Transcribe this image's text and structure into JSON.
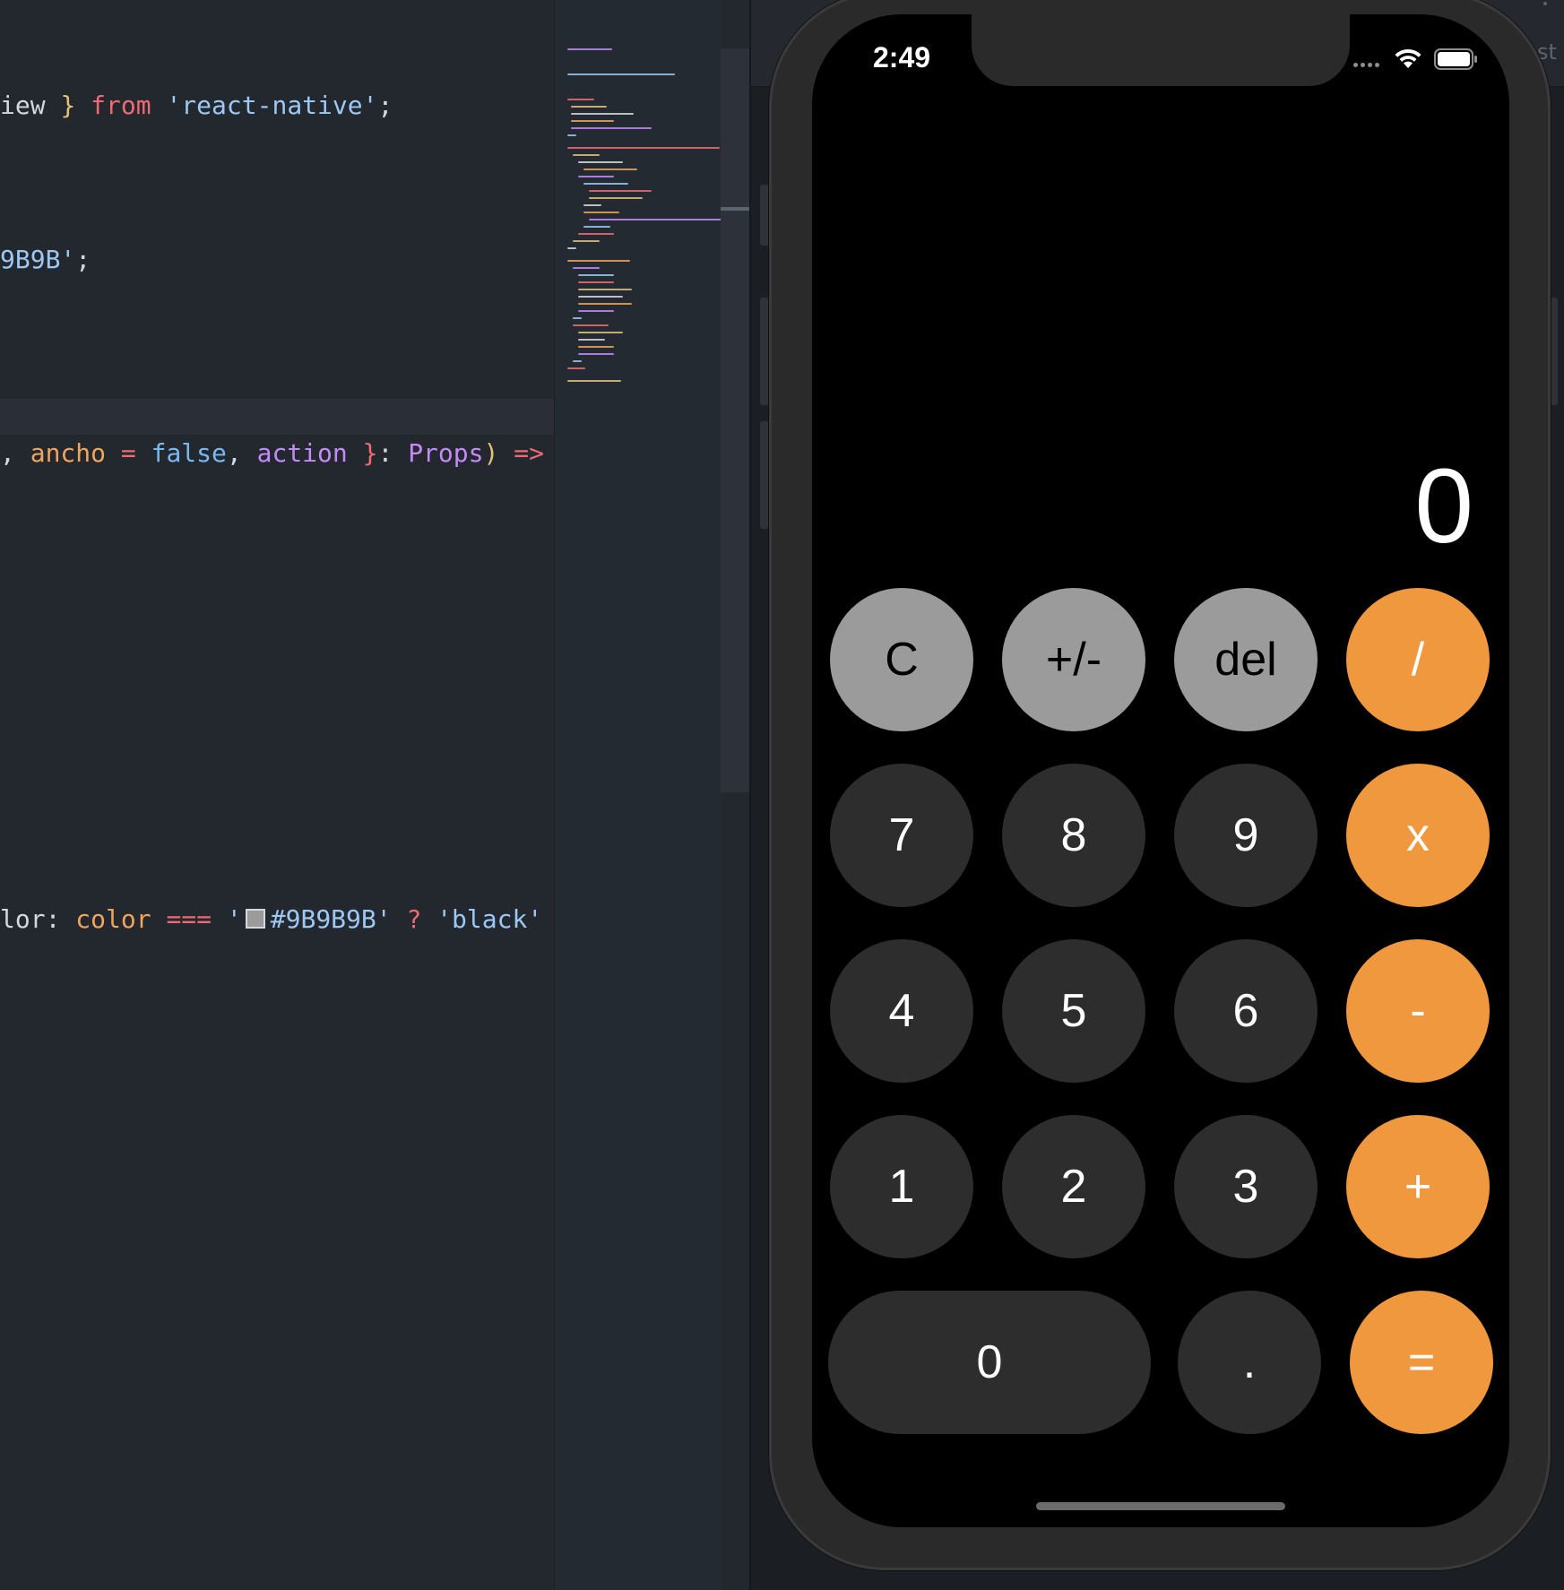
{
  "editor": {
    "lines": [
      [
        [
          "tk-plain",
          "iew "
        ],
        [
          "tk-brace",
          "}"
        ],
        [
          "tk-kw",
          " from "
        ],
        [
          "tk-str",
          "'react-native'"
        ],
        [
          "tk-plain",
          ";"
        ]
      ],
      [
        [
          "tk-str",
          "9B9B'"
        ],
        [
          "tk-plain",
          ";"
        ]
      ],
      [
        [
          "tk-plain",
          ", "
        ],
        [
          "tk-param",
          "ancho"
        ],
        [
          "tk-op",
          " = "
        ],
        [
          "tk-bool",
          "false"
        ],
        [
          "tk-plain",
          ", "
        ],
        [
          "tk-name",
          "action"
        ],
        [
          "tk-plain",
          " "
        ],
        [
          "tk-kw",
          "}"
        ],
        [
          "tk-plain",
          ": "
        ],
        [
          "tk-type",
          "Props"
        ],
        [
          "tk-paren",
          ")"
        ],
        [
          "tk-op",
          " =>"
        ]
      ],
      [
        [
          "tk-plain",
          "lor: "
        ],
        [
          "tk-param",
          "color"
        ],
        [
          "tk-op",
          " === "
        ],
        [
          "tk-str",
          "'"
        ],
        [
          "swatch",
          ""
        ],
        [
          "tk-str",
          "#9B9B9B'"
        ],
        [
          "tk-op",
          " ? "
        ],
        [
          "tk-str",
          "'black'"
        ]
      ]
    ]
  },
  "simulator": {
    "side_text": "st"
  },
  "phone": {
    "status": {
      "time": "2:49",
      "wifi_icon": "wifi-icon",
      "battery_icon": "battery-icon",
      "signal_icon": "cellular-signal-icon"
    },
    "display_value": "0",
    "colors": {
      "light_gray": "#9B9B9B",
      "dark_gray": "#2D2D2D",
      "orange": "#F0983E",
      "background": "#000000"
    },
    "buttons": [
      [
        {
          "label": "C",
          "style": "light",
          "name": "clear-button"
        },
        {
          "label": "+/-",
          "style": "light",
          "name": "toggle-sign-button"
        },
        {
          "label": "del",
          "style": "light",
          "name": "delete-button"
        },
        {
          "label": "/",
          "style": "orange",
          "name": "divide-button"
        }
      ],
      [
        {
          "label": "7",
          "style": "dark",
          "name": "digit-7-button"
        },
        {
          "label": "8",
          "style": "dark",
          "name": "digit-8-button"
        },
        {
          "label": "9",
          "style": "dark",
          "name": "digit-9-button"
        },
        {
          "label": "x",
          "style": "orange",
          "name": "multiply-button"
        }
      ],
      [
        {
          "label": "4",
          "style": "dark",
          "name": "digit-4-button"
        },
        {
          "label": "5",
          "style": "dark",
          "name": "digit-5-button"
        },
        {
          "label": "6",
          "style": "dark",
          "name": "digit-6-button"
        },
        {
          "label": "-",
          "style": "orange",
          "name": "subtract-button"
        }
      ],
      [
        {
          "label": "1",
          "style": "dark",
          "name": "digit-1-button"
        },
        {
          "label": "2",
          "style": "dark",
          "name": "digit-2-button"
        },
        {
          "label": "3",
          "style": "dark",
          "name": "digit-3-button"
        },
        {
          "label": "+",
          "style": "orange",
          "name": "add-button"
        }
      ],
      [
        {
          "label": "0",
          "style": "dark",
          "name": "digit-0-button",
          "wide": true
        },
        {
          "label": ".",
          "style": "dark",
          "name": "decimal-button"
        },
        {
          "label": "=",
          "style": "orange",
          "name": "equals-button"
        }
      ]
    ]
  }
}
